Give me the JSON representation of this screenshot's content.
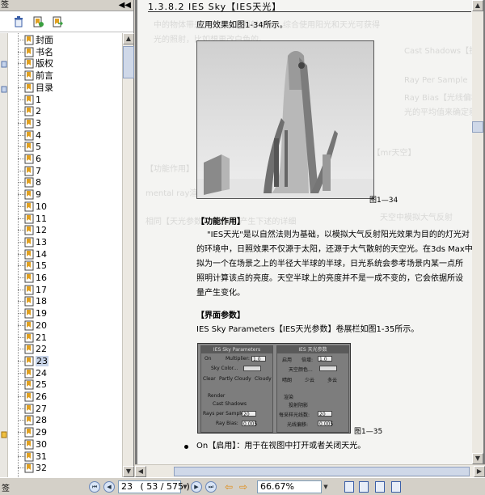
{
  "bookmarks_panel": {
    "title": "签",
    "items": [
      "封面",
      "书名",
      "版权",
      "前言",
      "目录",
      "1",
      "2",
      "3",
      "4",
      "5",
      "6",
      "7",
      "8",
      "9",
      "10",
      "11",
      "12",
      "13",
      "14",
      "15",
      "16",
      "17",
      "18",
      "19",
      "20",
      "21",
      "22",
      "23",
      "24",
      "25",
      "26",
      "27",
      "28",
      "29",
      "30",
      "31",
      "32"
    ],
    "selected": "23",
    "icons": [
      "trash-icon",
      "bookmark-add-icon",
      "bookmark-goto-icon"
    ]
  },
  "document": {
    "section_title": "1.3.8.2  IES Sky【IES天光】",
    "intro": "应用效果如图1-34所示。",
    "figure1_caption": "图1—34",
    "heading_function": "【功能作用】",
    "function_lines": [
      "\"IES天光\"是以自然法则为基础，以模拟大气反射阳光效果为目的的灯光对",
      "的环境中，日照效果不仅源于太阳，还源于大气散射的天空光。在3ds Max中",
      "拟为一个在场景之上的半径大半球的半球，日光系统会参考场景内某一点所",
      "照明计算该点的亮度。天空半球上的亮度并不是一成不变的，它会依据所设",
      "量产生变化。"
    ],
    "heading_interface": "【界面参数】",
    "interface_line": "IES Sky Parameters【IES天光参数】卷展栏如图1-35所示。",
    "figure2_caption": "图1—35",
    "bullet_line": "On【启用】：用于在视图中打开或者关闭天光。",
    "bleed_lines": [
      "中的物体带来了天空光的照射效果，综合使用阳光和天光可获得",
      "光的照射，比如想更改白色的。",
      "Cast Shadows【投射阴影】：使对象",
      "Ray Per Sample【每采样光线数】",
      "Ray Bias【光线偏移】：设置对象",
      "光的平均值来确定射线",
      "m Sky【mr天空】",
      "【功能作用】",
      "mental ray渲染器",
      "天空中模拟大气反射",
      "相同【天光参数】设置 — 产生下述的详细"
    ],
    "panel_left": {
      "title": "IES Sky Parameters",
      "on": "On",
      "multiplier": "Multiplier:",
      "multiplier_val": "1.0",
      "sky_color": "Sky Color...",
      "clear": "Clear",
      "partly": "Partly Cloudy",
      "cloudy": "Cloudy",
      "render": "Render",
      "cast_shadows": "Cast Shadows",
      "rays": "Rays per Sample:",
      "rays_val": "20",
      "ray_bias": "Ray Bias:",
      "ray_bias_val": "0.005"
    },
    "panel_right": {
      "title": "IES 天光参数",
      "on": "启用",
      "multiplier": "倍增:",
      "multiplier_val": "1.0",
      "sky_color": "天空颜色...",
      "clear": "晴朗",
      "partly": "少云",
      "cloudy": "多云",
      "render": "渲染",
      "cast_shadows": "投射阴影",
      "rays": "每采样光线数:",
      "rays_val": "20",
      "ray_bias": "光线偏移:",
      "ray_bias_val": "0.005"
    }
  },
  "navbar": {
    "page_value": "23",
    "page_count": "( 53 / 575 )",
    "zoom": "66.67%",
    "left_label": "签"
  },
  "colors": {
    "selection": "#c8d4e8",
    "doc_bg": "#7a7a7a",
    "page_bg": "#f4f4f2",
    "nav_arrow": "#e08a10"
  }
}
